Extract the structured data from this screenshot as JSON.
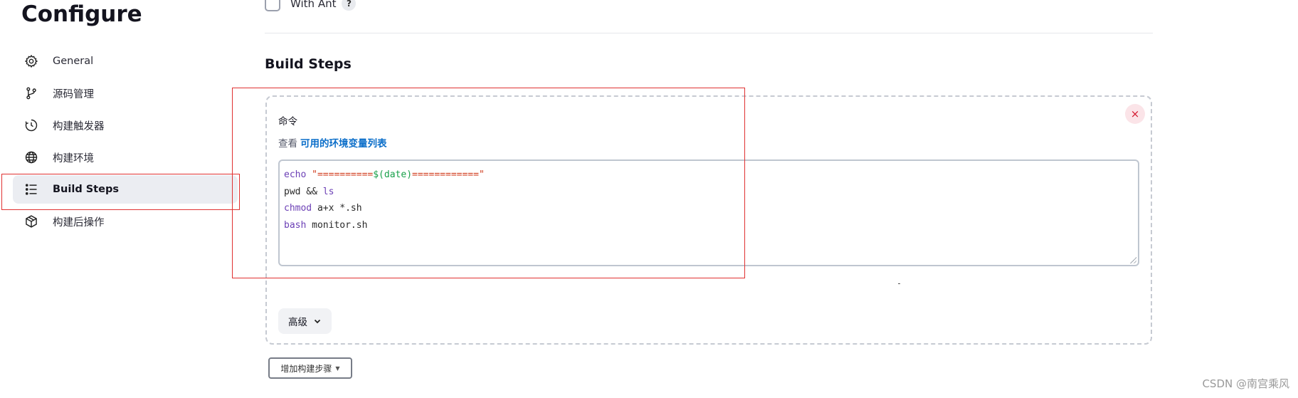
{
  "page": {
    "title": "Configure"
  },
  "sidebar": {
    "items": [
      {
        "label": "General",
        "icon": "gear-icon",
        "active": false
      },
      {
        "label": "源码管理",
        "icon": "branch-icon",
        "active": false
      },
      {
        "label": "构建触发器",
        "icon": "timer-icon",
        "active": false
      },
      {
        "label": "构建环境",
        "icon": "globe-icon",
        "active": false
      },
      {
        "label": "Build Steps",
        "icon": "list-icon",
        "active": true
      },
      {
        "label": "构建后操作",
        "icon": "package-icon",
        "active": false
      }
    ]
  },
  "main": {
    "with_ant": {
      "label": "With Ant",
      "checked": false,
      "help": "?"
    },
    "section_title": "Build Steps",
    "step": {
      "label": "命令",
      "env_prefix": "查看",
      "env_link": "可用的环境变量列表",
      "close_symbol": "×",
      "code_lines": [
        [
          {
            "t": "echo",
            "c": "kw"
          },
          {
            "t": " ",
            "c": ""
          },
          {
            "t": "\"==========",
            "c": "str"
          },
          {
            "t": "$(date)",
            "c": "str-in"
          },
          {
            "t": "============\"",
            "c": "str"
          }
        ],
        [
          {
            "t": "pwd && ",
            "c": ""
          },
          {
            "t": "ls",
            "c": "kw"
          }
        ],
        [
          {
            "t": "chmod",
            "c": "kw"
          },
          {
            "t": " a+x *.sh",
            "c": ""
          }
        ],
        [
          {
            "t": "bash",
            "c": "kw"
          },
          {
            "t": " monitor.sh",
            "c": ""
          }
        ]
      ],
      "advanced_label": "高级"
    },
    "add_step_label": "增加构建步骤"
  },
  "watermark": "CSDN @南宫乘风",
  "colors": {
    "accent_link": "#0b6ec9",
    "annotation_red": "#e03131",
    "active_nav_bg": "#ebedf2"
  }
}
